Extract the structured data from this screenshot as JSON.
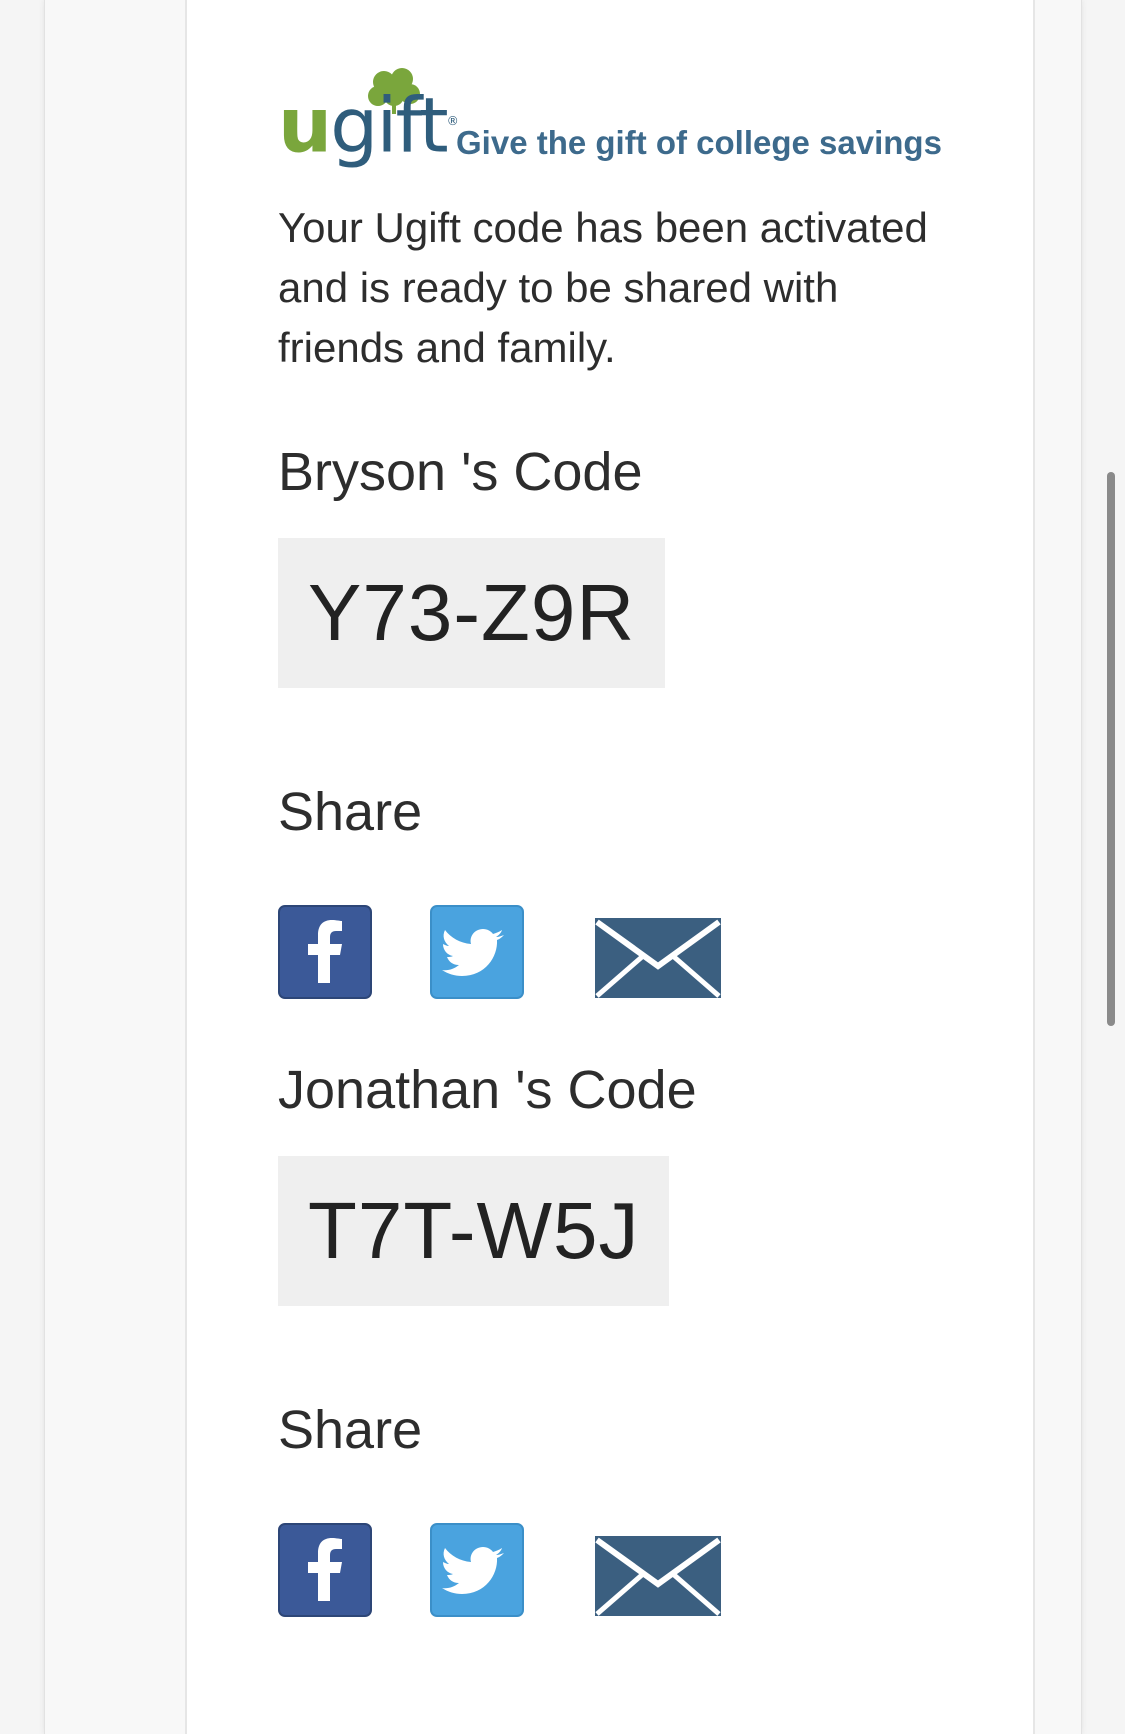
{
  "logo": {
    "letter_u": "u",
    "word_rest": "gift",
    "registered_mark": "®",
    "tagline": "Give the gift of college savings",
    "brand_green": "#7aa63c",
    "brand_blue": "#2f5d7c"
  },
  "intro_text": "Your Ugift code has been activated and is ready to be shared with friends and family.",
  "codes": [
    {
      "title": "Bryson 's Code",
      "code": "Y73-Z9R",
      "share_label": "Share",
      "share_icons": [
        "facebook-icon",
        "twitter-icon",
        "email-icon"
      ]
    },
    {
      "title": "Jonathan 's Code",
      "code": "T7T-W5J",
      "share_label": "Share",
      "share_icons": [
        "facebook-icon",
        "twitter-icon",
        "email-icon"
      ]
    }
  ],
  "colors": {
    "facebook": "#3b5998",
    "twitter": "#4aa3df",
    "email": "#3b5f80",
    "code_box_bg": "#efefef"
  }
}
